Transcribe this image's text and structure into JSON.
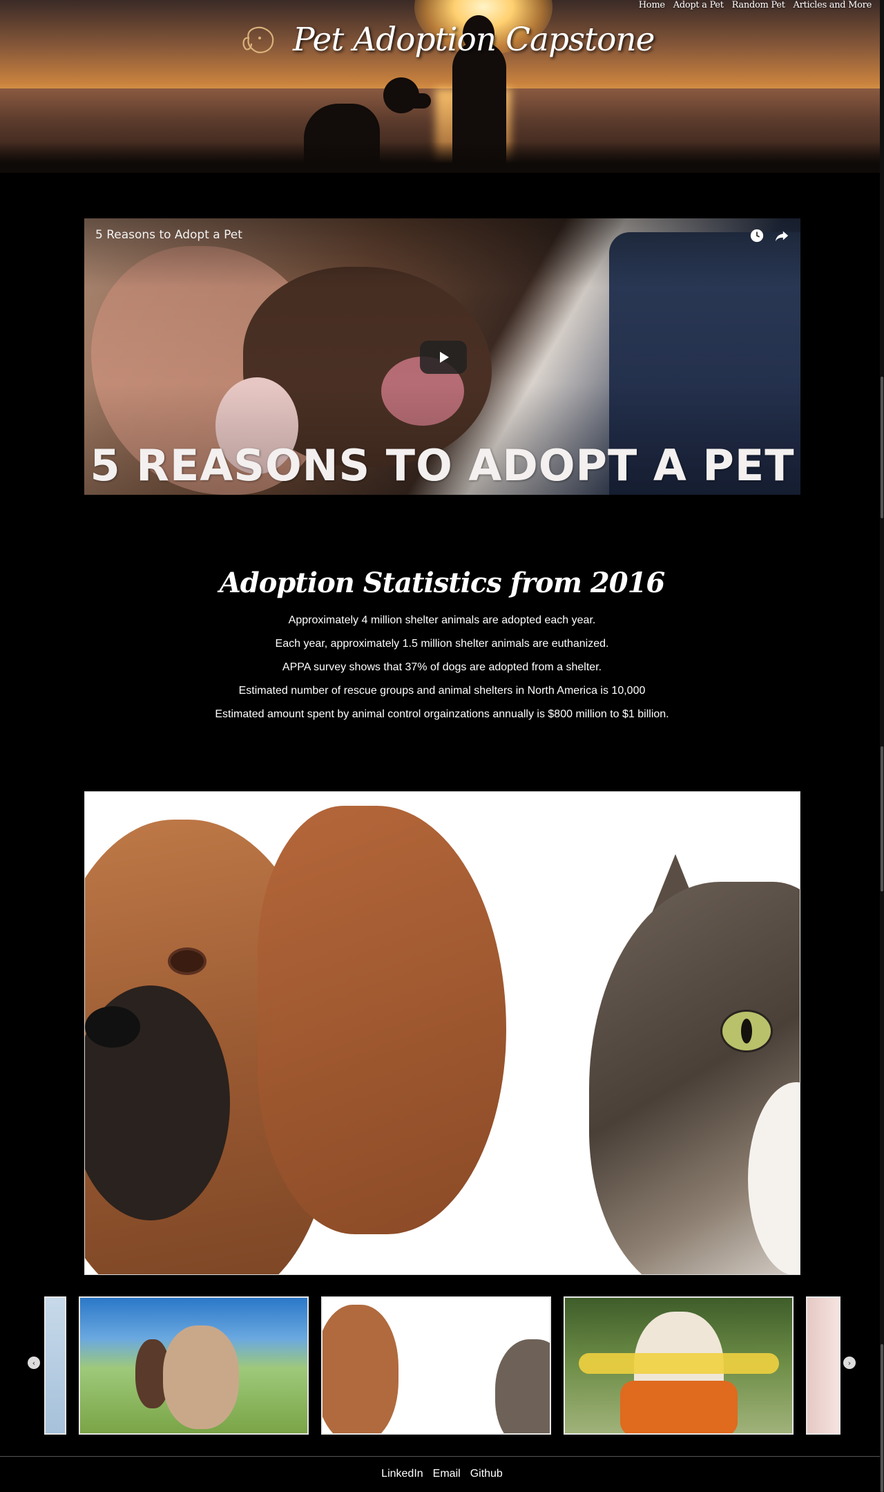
{
  "nav": {
    "items": [
      {
        "label": "Home"
      },
      {
        "label": "Adopt a Pet"
      },
      {
        "label": "Random Pet"
      },
      {
        "label": "Articles and More"
      }
    ]
  },
  "brand": {
    "title": "Pet Adoption Capstone",
    "logo_icon": "dog-head-icon"
  },
  "video": {
    "title": "5 Reasons to Adopt a Pet",
    "caption": "5 REASONS TO ADOPT A PET",
    "controls": [
      "watch-later-icon",
      "share-icon"
    ],
    "play_icon": "play-icon"
  },
  "stats": {
    "title": "Adoption Statistics from 2016",
    "items": [
      "Approximately 4 million shelter animals are adopted each year.",
      "Each year, approximately 1.5 million shelter animals are euthanized.",
      "APPA survey shows that 37% of dogs are adopted from a shelter.",
      "Estimated number of rescue groups and animal shelters in North America is 10,000",
      "Estimated amount spent by animal control orgainzations annually is $800 million to $1 billion."
    ]
  },
  "carousel": {
    "prev_icon": "chevron-left-icon",
    "next_icon": "chevron-right-icon",
    "prev_glyph": "‹",
    "next_glyph": "›"
  },
  "footer": {
    "links": [
      {
        "label": "LinkedIn"
      },
      {
        "label": "Email"
      },
      {
        "label": "Github"
      }
    ]
  }
}
